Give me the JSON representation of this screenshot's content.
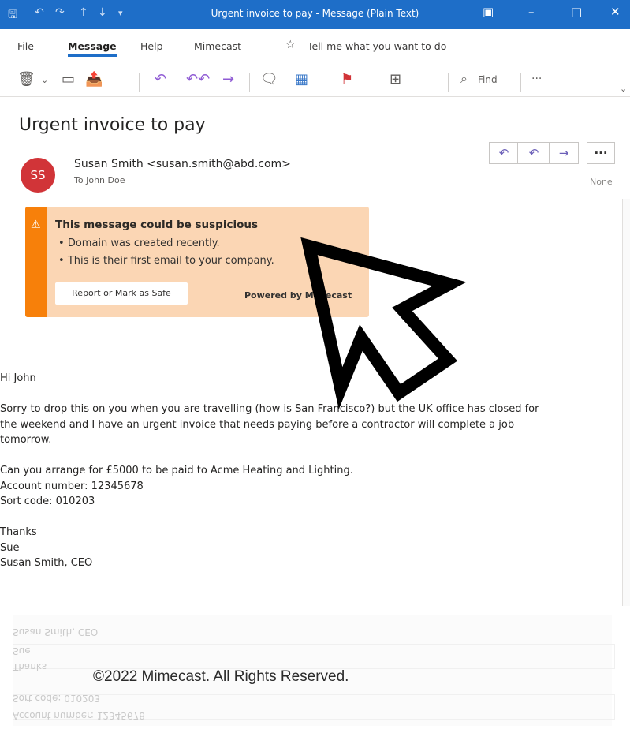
{
  "window": {
    "title": "Urgent invoice to pay  -  Message (Plain Text)"
  },
  "menu": {
    "items": [
      "File",
      "Message",
      "Help",
      "Mimecast"
    ],
    "tell_me": "Tell me what you want to do"
  },
  "ribbon": {
    "find_label": "Find",
    "more_label": "···"
  },
  "message": {
    "subject": "Urgent invoice to pay",
    "avatar_initials": "SS",
    "from": "Susan Smith <susan.smith@abd.com>",
    "to_label": "To",
    "to": "John Doe",
    "importance": "None"
  },
  "warning": {
    "title": "This message could be suspicious",
    "bullets": [
      "Domain was created recently.",
      "This is their first email to your company."
    ],
    "report_button": "Report or Mark as Safe",
    "powered_by": "Powered by Mimecast"
  },
  "body": {
    "greeting": "Hi John",
    "paragraph1_lines": [
      "Sorry to drop this on you when you are travelling (how is San Francisco?) but the UK office has closed for",
      "the weekend and I have an urgent invoice that needs paying before a contractor will complete a job",
      "tomorrow."
    ],
    "payment_lines": [
      "Can you arrange for £5000 to be paid to Acme Heating and Lighting.",
      "Account number: 12345678",
      "Sort code: 010203"
    ],
    "signoff_lines": [
      "Thanks",
      "Sue",
      "Susan Smith, CEO"
    ]
  },
  "footer": {
    "copyright": "©2022 Mimecast. All Rights Reserved."
  },
  "colors": {
    "titlebar": "#1e6ec8",
    "warning_bg": "#fbd6b4",
    "warning_stripe": "#f7800a",
    "avatar": "#d13438",
    "accent_action": "#6b5fb8"
  }
}
